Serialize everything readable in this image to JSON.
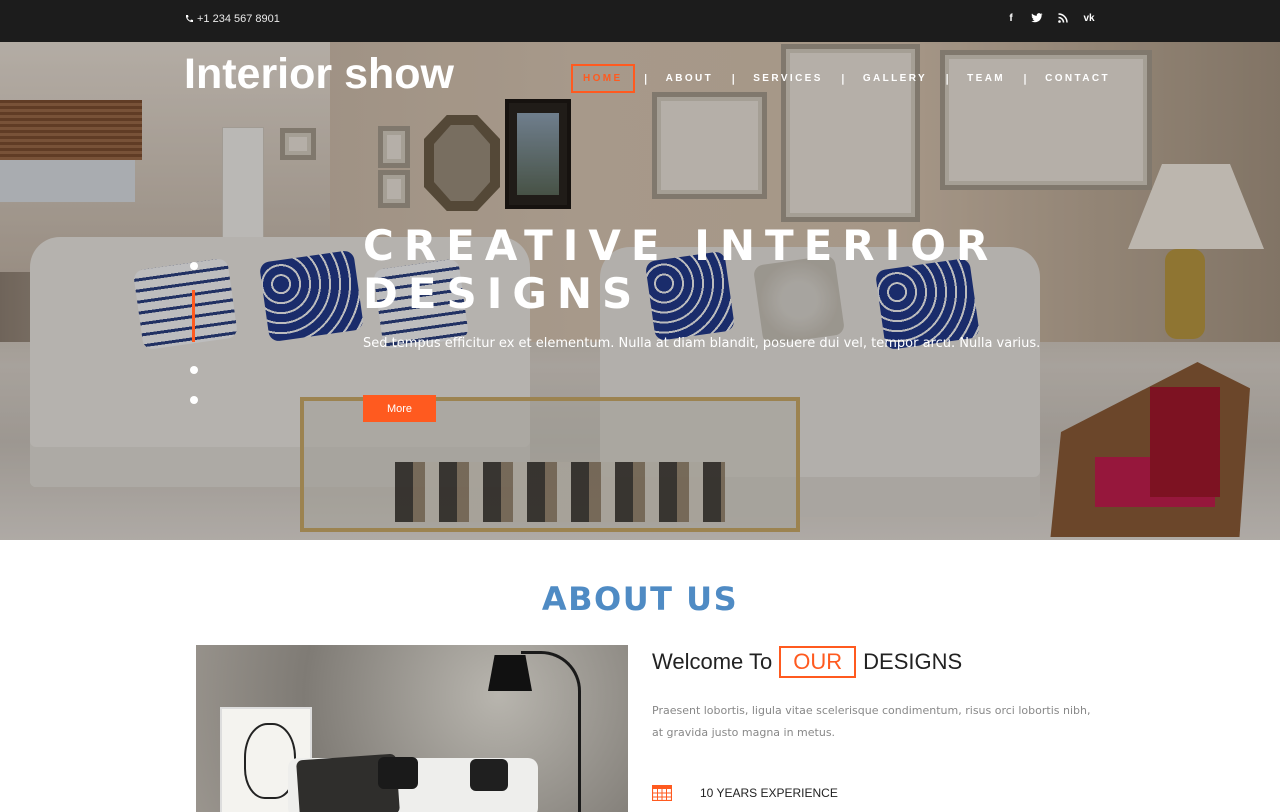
{
  "topbar": {
    "phone": "+1 234 567 8901",
    "social": [
      {
        "icon": "facebook-icon",
        "glyph": "f"
      },
      {
        "icon": "twitter-icon",
        "glyph": "t"
      },
      {
        "icon": "rss-icon",
        "glyph": "r"
      },
      {
        "icon": "vk-icon",
        "glyph": "vk"
      }
    ]
  },
  "brand": "Interior show",
  "nav": {
    "items": [
      "HOME",
      "ABOUT",
      "SERVICES",
      "GALLERY",
      "TEAM",
      "CONTACT"
    ],
    "separator": "|",
    "active": "HOME"
  },
  "hero": {
    "title": "CREATIVE INTERIOR DESIGNS",
    "subtitle": "Sed tempus efficitur ex et elementum. Nulla at diam blandit, posuere dui vel, tempor arcu. Nulla varius.",
    "button": "More",
    "slides": 4,
    "active_slide": 2
  },
  "about": {
    "title": "ABOUT US",
    "welcome_before": "Welcome To",
    "welcome_highlight": "OUR",
    "welcome_after": "DESIGNS",
    "text": "Praesent lobortis, ligula vitae scelerisque condimentum, risus orci lobortis nibh, at gravida justo magna in metus.",
    "feature": "10 YEARS EXPERIENCE",
    "feature_icon": "calendar-grid-icon"
  },
  "colors": {
    "accent": "#ff5a1f",
    "heading_blue": "#4f8bc4",
    "topbar": "#1c1c1c"
  }
}
